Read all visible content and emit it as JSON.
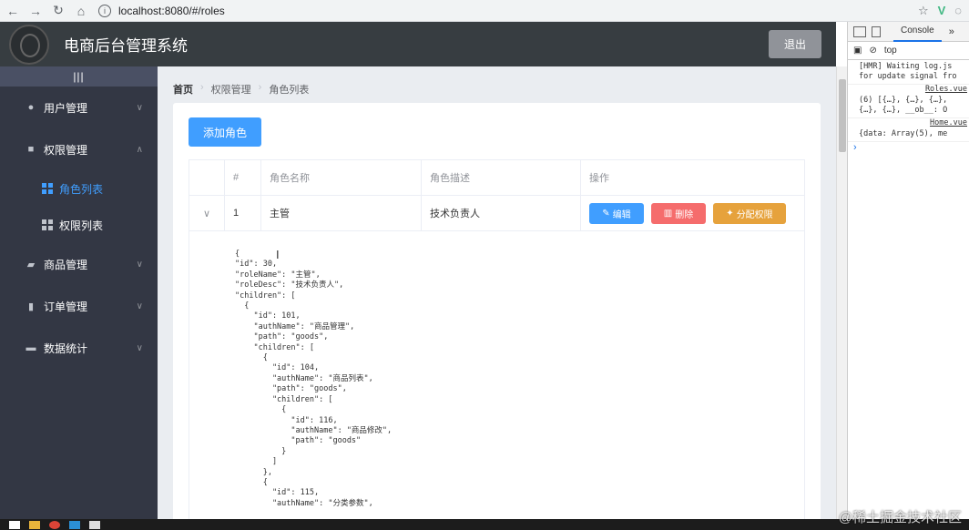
{
  "browser": {
    "url": "localhost:8080/#/roles"
  },
  "header": {
    "title": "电商后台管理系统",
    "logout": "退出"
  },
  "sidebar": {
    "toggle": "|||",
    "items": [
      {
        "label": "用户管理",
        "icon": "user-icon"
      },
      {
        "label": "权限管理",
        "icon": "box-icon",
        "open": true
      },
      {
        "label": "商品管理",
        "icon": "bag-icon"
      },
      {
        "label": "订单管理",
        "icon": "document-icon"
      },
      {
        "label": "数据统计",
        "icon": "chart-icon"
      }
    ],
    "subitems": [
      {
        "label": "角色列表",
        "active": true
      },
      {
        "label": "权限列表",
        "active": false
      }
    ]
  },
  "breadcrumb": [
    "首页",
    "权限管理",
    "角色列表"
  ],
  "card": {
    "add_button": "添加角色"
  },
  "table": {
    "headers": [
      "#",
      "角色名称",
      "角色描述",
      "操作"
    ],
    "rows": [
      {
        "index": "1",
        "name": "主管",
        "desc": "技术负责人"
      }
    ],
    "actions": {
      "edit": "编辑",
      "delete": "删除",
      "assign": "分配权限"
    }
  },
  "json_text": "{\n\"id\": 30,\n\"roleName\": \"主管\",\n\"roleDesc\": \"技术负责人\",\n\"children\": [\n  {\n    \"id\": 101,\n    \"authName\": \"商品管理\",\n    \"path\": \"goods\",\n    \"children\": [\n      {\n        \"id\": 104,\n        \"authName\": \"商品列表\",\n        \"path\": \"goods\",\n        \"children\": [\n          {\n            \"id\": 116,\n            \"authName\": \"商品修改\",\n            \"path\": \"goods\"\n          }\n        ]\n      },\n      {\n        \"id\": 115,\n        \"authName\": \"分类参数\",",
  "devtools": {
    "tab": "Console",
    "context": "top",
    "log1": "[HMR] Waiting log.js\nfor update signal fro",
    "link1": "Roles.vue",
    "log2": "(6) [{…}, {…}, {…},\n{…}, {…}, __ob__: O",
    "link2": "Home.vue",
    "log3": "{data: Array(5), me"
  },
  "watermark": "@稀土掘金技术社区"
}
